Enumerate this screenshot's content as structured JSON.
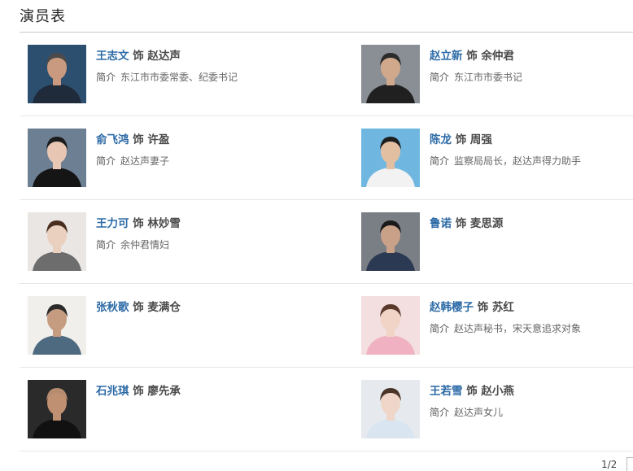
{
  "section": {
    "title": "演员表"
  },
  "cast": [
    {
      "actor": "王志文",
      "role": "赵达声",
      "desc": "东江市市委常委、纪委书记",
      "photo": {
        "bg": "#2d4f6f",
        "skin": "#c99a7f",
        "hair": "#4a4a4a",
        "cloth": "#1f2a3a"
      }
    },
    {
      "actor": "赵立新",
      "role": "余仲君",
      "desc": "东江市市委书记",
      "photo": {
        "bg": "#8a8f95",
        "skin": "#d0a88b",
        "hair": "#2b2b2b",
        "cloth": "#202020"
      }
    },
    {
      "actor": "俞飞鸿",
      "role": "许盈",
      "desc": "赵达声妻子",
      "photo": {
        "bg": "#6d7f92",
        "skin": "#e7c7b3",
        "hair": "#1c1c1c",
        "cloth": "#151515"
      }
    },
    {
      "actor": "陈龙",
      "role": "周强",
      "desc": "监察局局长，赵达声得力助手",
      "photo": {
        "bg": "#6fb7e0",
        "skin": "#e3bfa2",
        "hair": "#1e1e1e",
        "cloth": "#f2f2f2"
      }
    },
    {
      "actor": "王力可",
      "role": "林妙雪",
      "desc": "余仲君情妇",
      "photo": {
        "bg": "#e9e6e3",
        "skin": "#ead0be",
        "hair": "#4a2e1f",
        "cloth": "#6d6d6d"
      }
    },
    {
      "actor": "鲁诺",
      "role": "麦思源",
      "desc": "",
      "photo": {
        "bg": "#7a7e85",
        "skin": "#c9a088",
        "hair": "#1a1a1a",
        "cloth": "#2b3a52"
      }
    },
    {
      "actor": "张秋歌",
      "role": "麦满仓",
      "desc": "",
      "photo": {
        "bg": "#f0efec",
        "skin": "#c59c80",
        "hair": "#2a2a2a",
        "cloth": "#4e6a80"
      }
    },
    {
      "actor": "赵韩樱子",
      "role": "苏红",
      "desc": "赵达声秘书，宋天意追求对象",
      "photo": {
        "bg": "#f3dfe0",
        "skin": "#f1d4c6",
        "hair": "#5a3a2a",
        "cloth": "#f0b2c2"
      }
    },
    {
      "actor": "石兆琪",
      "role": "廖先承",
      "desc": "",
      "photo": {
        "bg": "#2a2a2a",
        "skin": "#bf9072",
        "hair": "#b58c70",
        "cloth": "#111111"
      }
    },
    {
      "actor": "王若雪",
      "role": "赵小燕",
      "desc": "赵达声女儿",
      "photo": {
        "bg": "#e6eaee",
        "skin": "#efd6c8",
        "hair": "#4b3428",
        "cloth": "#d9e6f2"
      }
    }
  ],
  "labels": {
    "plays": "饰",
    "intro": "简介"
  },
  "pager": {
    "text": "1/2"
  }
}
